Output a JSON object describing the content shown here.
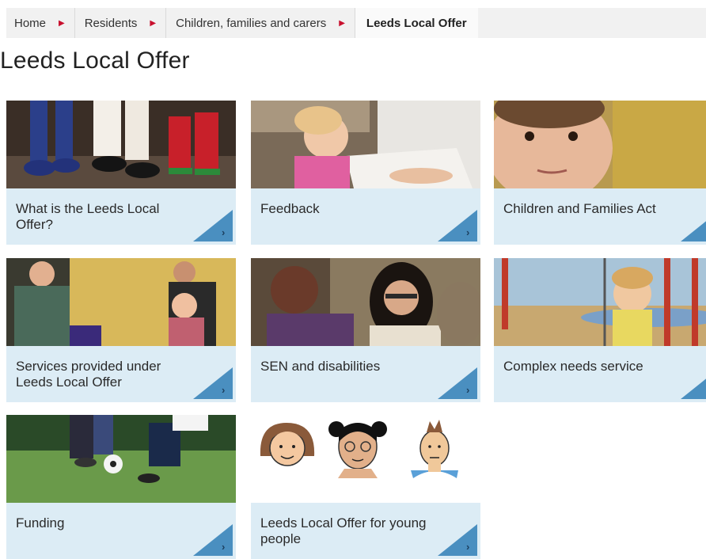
{
  "breadcrumb": {
    "items": [
      {
        "label": "Home"
      },
      {
        "label": "Residents"
      },
      {
        "label": "Children, families and carers"
      }
    ],
    "current": "Leeds Local Offer"
  },
  "page": {
    "title": "Leeds Local Offer"
  },
  "tiles": [
    {
      "label": "What is the Leeds Local Offer?"
    },
    {
      "label": "Feedback"
    },
    {
      "label": "Children and Families Act"
    },
    {
      "label": "Services provided under Leeds Local Offer"
    },
    {
      "label": "SEN and disabilities"
    },
    {
      "label": "Complex needs service"
    },
    {
      "label": "Funding"
    },
    {
      "label": "Leeds Local Offer for young people"
    }
  ],
  "colors": {
    "caption_bg": "#dcecf5",
    "arrow_bg": "#4a8fc0",
    "separator": "#c8102e"
  }
}
